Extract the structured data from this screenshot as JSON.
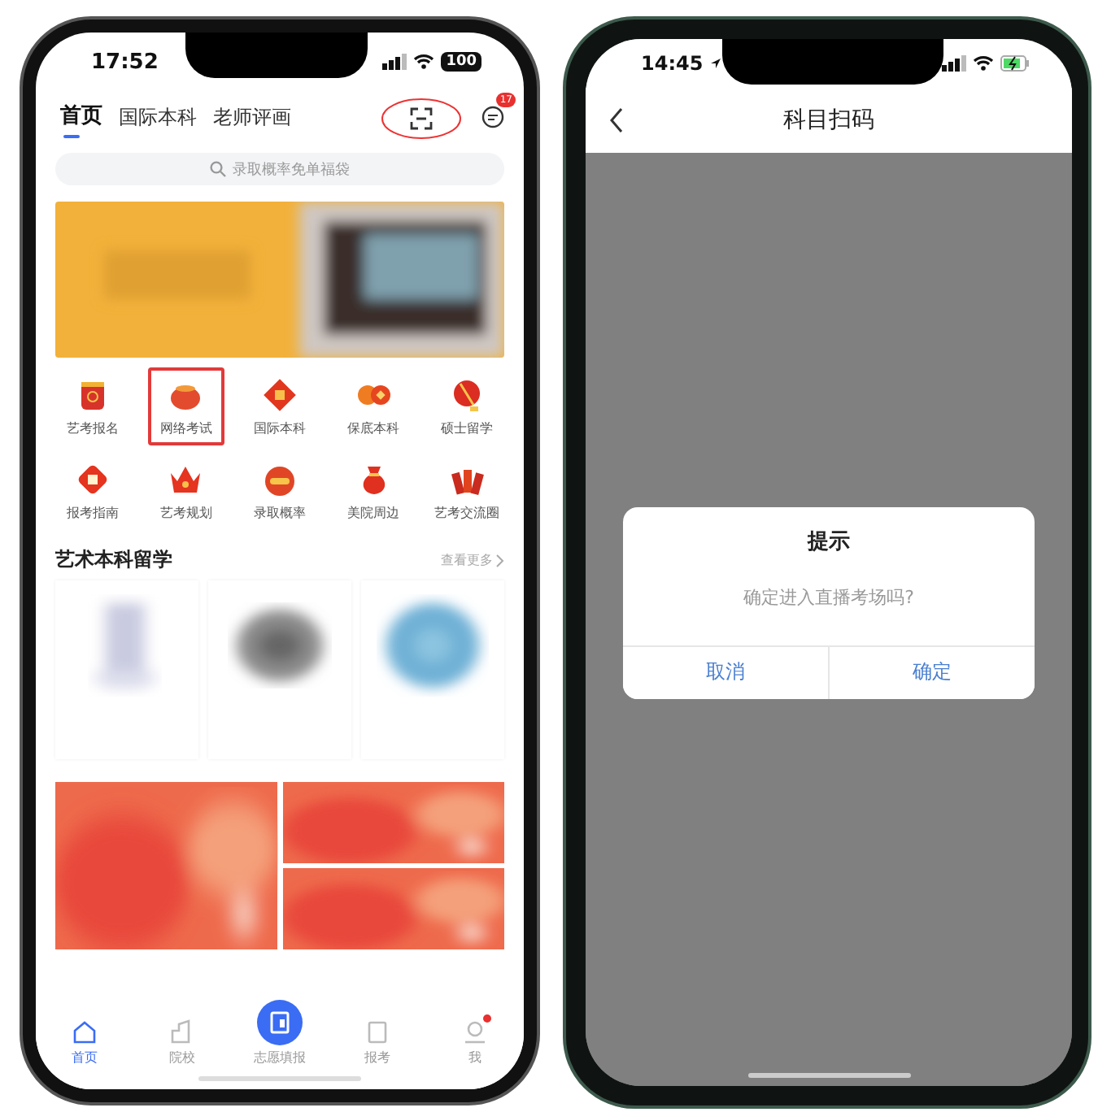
{
  "left_phone": {
    "status_bar": {
      "time": "17:52",
      "battery": "100"
    },
    "top_tabs": [
      {
        "label": "首页",
        "selected": true
      },
      {
        "label": "国际本科",
        "selected": false
      },
      {
        "label": "老师评画",
        "selected": false
      }
    ],
    "scan_annotated": true,
    "message_badge": "17",
    "search": {
      "placeholder": "录取概率免单福袋"
    },
    "shortcuts": [
      {
        "label": "艺考报名",
        "kind": "drum",
        "highlighted": false
      },
      {
        "label": "网络考试",
        "kind": "pot",
        "highlighted": true
      },
      {
        "label": "国际本科",
        "kind": "diamond",
        "highlighted": false
      },
      {
        "label": "保底本科",
        "kind": "coins",
        "highlighted": false
      },
      {
        "label": "硕士留学",
        "kind": "lantern",
        "highlighted": false
      },
      {
        "label": "报考指南",
        "kind": "card",
        "highlighted": false
      },
      {
        "label": "艺考规划",
        "kind": "crown",
        "highlighted": false
      },
      {
        "label": "录取概率",
        "kind": "lion",
        "highlighted": false
      },
      {
        "label": "美院周边",
        "kind": "bag",
        "highlighted": false
      },
      {
        "label": "艺考交流圈",
        "kind": "firecracker",
        "highlighted": false
      }
    ],
    "section": {
      "title": "艺术本科留学",
      "more": "查看更多"
    },
    "nav": [
      {
        "label": "首页",
        "kind": "home",
        "selected": true,
        "dot": false
      },
      {
        "label": "院校",
        "kind": "school",
        "selected": false,
        "dot": false
      },
      {
        "label": "志愿填报",
        "kind": "fab",
        "selected": false,
        "dot": false
      },
      {
        "label": "报考",
        "kind": "form",
        "selected": false,
        "dot": false
      },
      {
        "label": "我",
        "kind": "me",
        "selected": false,
        "dot": true
      }
    ]
  },
  "right_phone": {
    "status_bar": {
      "time": "14:45"
    },
    "title": "科目扫码",
    "dialog": {
      "title": "提示",
      "message": "确定进入直播考场吗?",
      "buttons": [
        "取消",
        "确定"
      ]
    }
  }
}
